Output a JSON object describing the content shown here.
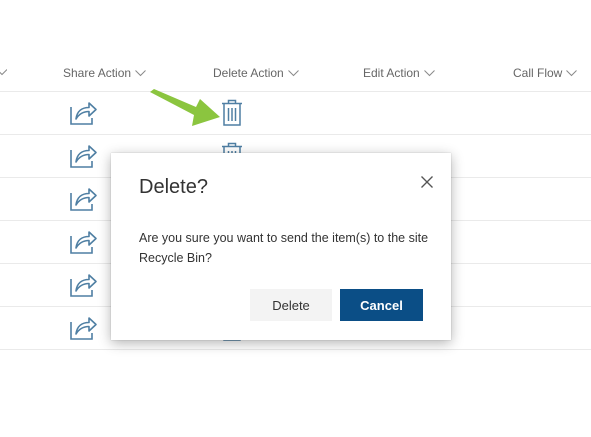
{
  "columns": [
    {
      "label": "Share Action"
    },
    {
      "label": "Delete Action"
    },
    {
      "label": "Edit Action"
    },
    {
      "label": "Call Flow"
    }
  ],
  "row_count": 6,
  "icons": {
    "header_sort": "chevron-down-icon",
    "share": "share-icon",
    "delete": "trash-icon",
    "pointer": "arrow-pointer-icon",
    "close": "close-icon"
  },
  "colors": {
    "icon_blue": "#4f7fa3",
    "accent_arrow": "#8bc53f",
    "primary_button": "#0b4e86",
    "secondary_button": "#f3f3f3"
  },
  "dialog": {
    "title": "Delete?",
    "message": "Are you sure you want to send the item(s) to the site Recycle Bin?",
    "confirm_label": "Delete",
    "cancel_label": "Cancel"
  }
}
